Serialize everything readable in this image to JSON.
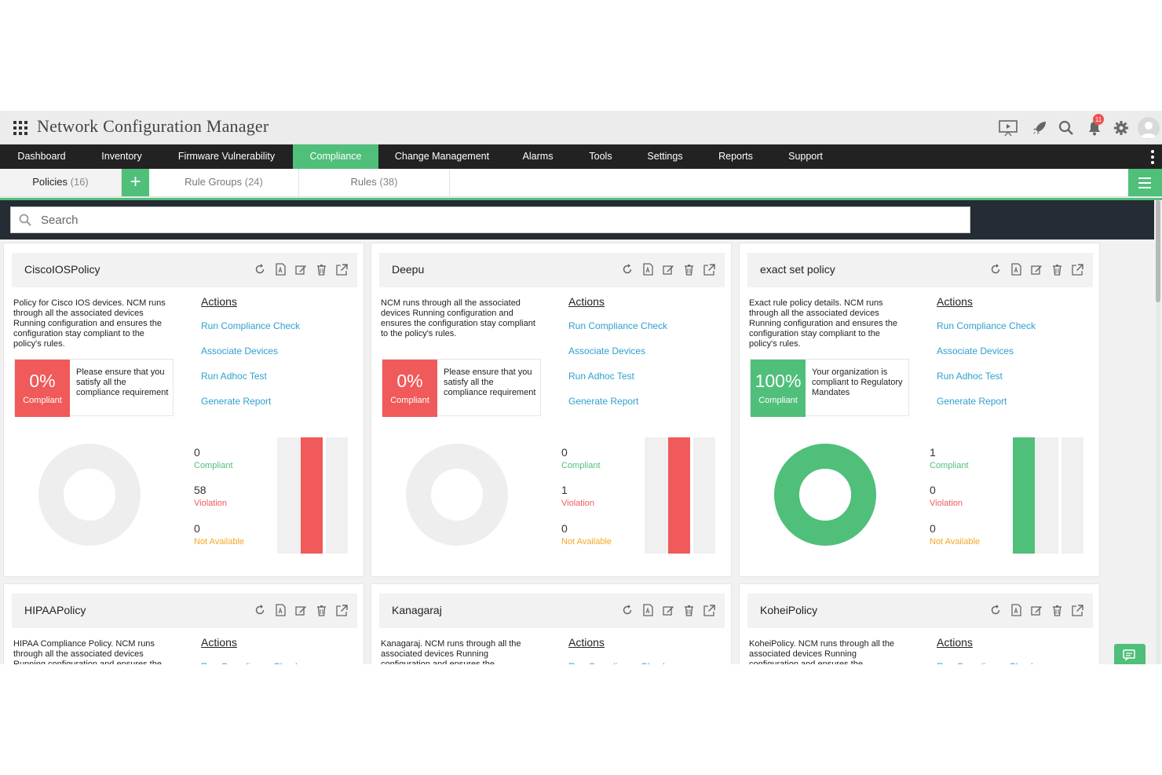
{
  "app": {
    "title": "Network Configuration Manager",
    "notification_count": "11"
  },
  "nav": {
    "items": [
      {
        "label": "Dashboard"
      },
      {
        "label": "Inventory"
      },
      {
        "label": "Firmware Vulnerability"
      },
      {
        "label": "Compliance",
        "active": true
      },
      {
        "label": "Change Management"
      },
      {
        "label": "Alarms"
      },
      {
        "label": "Tools"
      },
      {
        "label": "Settings"
      },
      {
        "label": "Reports"
      },
      {
        "label": "Support"
      }
    ]
  },
  "tabs": {
    "policies_label": "Policies",
    "policies_count": "(16)",
    "rule_groups_label": "Rule Groups",
    "rule_groups_count": "(24)",
    "rules_label": "Rules",
    "rules_count": "(38)",
    "add_symbol": "+"
  },
  "search": {
    "placeholder": "Search"
  },
  "actions_heading": "Actions",
  "actions": [
    "Run Compliance Check",
    "Associate Devices",
    "Run Adhoc Test",
    "Generate Report"
  ],
  "stat_labels": {
    "compliant": "Compliant",
    "violation": "Violation",
    "not_available": "Not Available"
  },
  "colors": {
    "accent": "#4fbf7a",
    "danger": "#f05a5a",
    "warning": "#f5a623",
    "link": "#2fa0cf",
    "nav_bg": "#222222"
  },
  "policies": [
    {
      "name": "CiscoIOSPolicy",
      "description": "Policy for Cisco IOS devices. NCM runs through all the associated devices Running configuration and ensures the configuration stay compliant to the policy's rules.",
      "compliance_percent": "0%",
      "compliance_label": "Compliant",
      "message": "Please ensure that you satisfy all the compliance requirement",
      "status": "noncompliant",
      "compliant": "0",
      "violation": "58",
      "not_available": "0"
    },
    {
      "name": "Deepu",
      "description": "NCM runs through all the associated devices Running configuration and ensures the configuration stay compliant to the policy's rules.",
      "compliance_percent": "0%",
      "compliance_label": "Compliant",
      "message": "Please ensure that you satisfy all the compliance requirement",
      "status": "noncompliant",
      "compliant": "0",
      "violation": "1",
      "not_available": "0"
    },
    {
      "name": "exact set policy",
      "description": "Exact rule policy details. NCM runs through all the associated devices Running configuration and ensures the configuration stay compliant to the policy's rules.",
      "compliance_percent": "100%",
      "compliance_label": "Compliant",
      "message": "Your organization is compliant to Regulatory Mandates",
      "status": "compliant",
      "compliant": "1",
      "violation": "0",
      "not_available": "0"
    },
    {
      "name": "HIPAAPolicy",
      "description": "HIPAA Compliance Policy. NCM runs through all the associated devices Running configuration and ensures the"
    },
    {
      "name": "Kanagaraj",
      "description": "Kanagaraj. NCM runs through all the associated devices Running configuration and ensures the configuration stay"
    },
    {
      "name": "KoheiPolicy",
      "description": "KoheiPolicy. NCM runs through all the associated devices Running configuration and ensures the configuration stay"
    }
  ]
}
